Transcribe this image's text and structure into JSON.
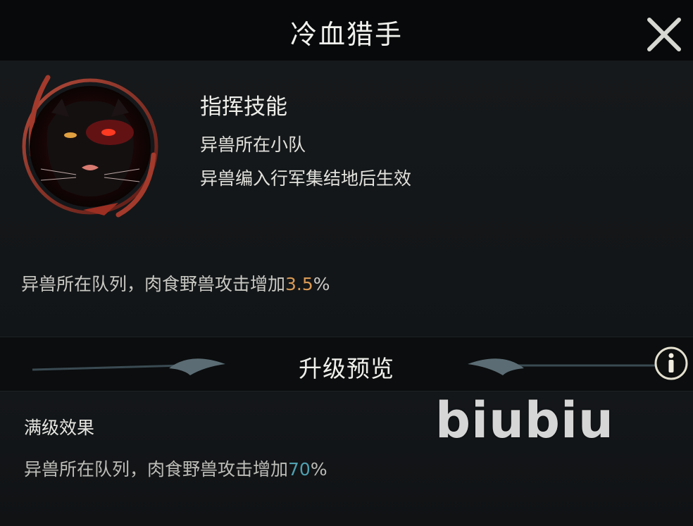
{
  "header": {
    "title": "冷血猎手"
  },
  "skill": {
    "icon": "black-panther-portrait-icon",
    "name": "指挥技能",
    "line1": "异兽所在小队",
    "line2": "异兽编入行军集结地后生效",
    "effect_prefix": "异兽所在队列，肉食野兽攻击增加",
    "effect_value": "3.5",
    "effect_suffix": "%"
  },
  "upgrade": {
    "title": "升级预览",
    "info_icon": "info-icon"
  },
  "max_level": {
    "label": "满级效果",
    "effect_prefix": "异兽所在队列，肉食野兽攻击增加",
    "effect_value": "70",
    "effect_suffix": "%"
  },
  "watermark": "biubiu",
  "colors": {
    "gold_value": "#d99a55",
    "teal_value": "#4fa0b0",
    "header_bg": "#07090a"
  }
}
